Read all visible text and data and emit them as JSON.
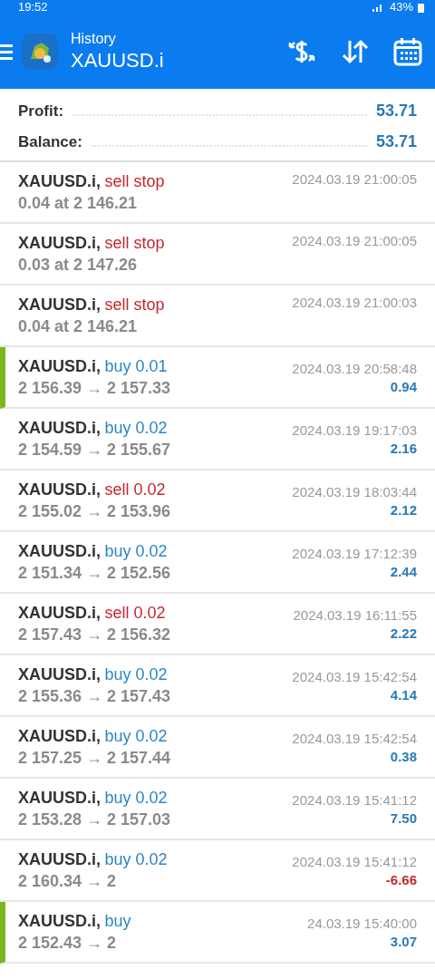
{
  "status_bar": {
    "time": "19:52",
    "battery": "43%"
  },
  "header": {
    "subtitle": "History",
    "title": "XAUUSD.i"
  },
  "summary": [
    {
      "label": "Profit:",
      "value": "53.71"
    },
    {
      "label": "Balance:",
      "value": "53.71"
    }
  ],
  "deals": [
    {
      "symbol": "XAUUSD.i,",
      "kind": "sell",
      "action": "sell stop",
      "detail": "0.04 at 2 146.21",
      "time": "2024.03.19 21:00:05",
      "marked": false
    },
    {
      "symbol": "XAUUSD.i,",
      "kind": "sell",
      "action": "sell stop",
      "detail": "0.03 at 2 147.26",
      "time": "2024.03.19 21:00:05",
      "marked": false
    },
    {
      "symbol": "XAUUSD.i,",
      "kind": "sell",
      "action": "sell stop",
      "detail": "0.04 at 2 146.21",
      "time": "2024.03.19 21:00:03",
      "marked": false
    },
    {
      "symbol": "XAUUSD.i,",
      "kind": "buy",
      "action": "buy 0.01",
      "detail": "2 156.39 → 2 157.33",
      "time": "2024.03.19 20:58:48",
      "profit": "0.94",
      "loss": false,
      "marked": true
    },
    {
      "symbol": "XAUUSD.i,",
      "kind": "buy",
      "action": "buy 0.02",
      "detail": "2 154.59 → 2 155.67",
      "time": "2024.03.19 19:17:03",
      "profit": "2.16",
      "loss": false,
      "marked": false
    },
    {
      "symbol": "XAUUSD.i,",
      "kind": "sell",
      "action": "sell 0.02",
      "detail": "2 155.02 → 2 153.96",
      "time": "2024.03.19 18:03:44",
      "profit": "2.12",
      "loss": false,
      "marked": false
    },
    {
      "symbol": "XAUUSD.i,",
      "kind": "buy",
      "action": "buy 0.02",
      "detail": "2 151.34 → 2 152.56",
      "time": "2024.03.19 17:12:39",
      "profit": "2.44",
      "loss": false,
      "marked": false
    },
    {
      "symbol": "XAUUSD.i,",
      "kind": "sell",
      "action": "sell 0.02",
      "detail": "2 157.43 → 2 156.32",
      "time": "2024.03.19 16:11:55",
      "profit": "2.22",
      "loss": false,
      "marked": false
    },
    {
      "symbol": "XAUUSD.i,",
      "kind": "buy",
      "action": "buy 0.02",
      "detail": "2 155.36 → 2 157.43",
      "time": "2024.03.19 15:42:54",
      "profit": "4.14",
      "loss": false,
      "marked": false
    },
    {
      "symbol": "XAUUSD.i,",
      "kind": "buy",
      "action": "buy 0.02",
      "detail": "2 157.25 → 2 157.44",
      "time": "2024.03.19 15:42:54",
      "profit": "0.38",
      "loss": false,
      "marked": false
    },
    {
      "symbol": "XAUUSD.i,",
      "kind": "buy",
      "action": "buy 0.02",
      "detail": "2 153.28 → 2 157.03",
      "time": "2024.03.19 15:41:12",
      "profit": "7.50",
      "loss": false,
      "marked": false
    },
    {
      "symbol": "XAUUSD.i,",
      "kind": "buy",
      "action": "buy 0.02",
      "detail": "2 160.34 → 2",
      "time": "2024.03.19 15:41:12",
      "profit": "-6.66",
      "loss": true,
      "marked": false
    },
    {
      "symbol": "XAUUSD.i,",
      "kind": "buy",
      "action": "buy",
      "detail": "2 152.43 → 2",
      "time": "24.03.19 15:40:00",
      "profit": "3.07",
      "loss": false,
      "marked": true
    }
  ]
}
